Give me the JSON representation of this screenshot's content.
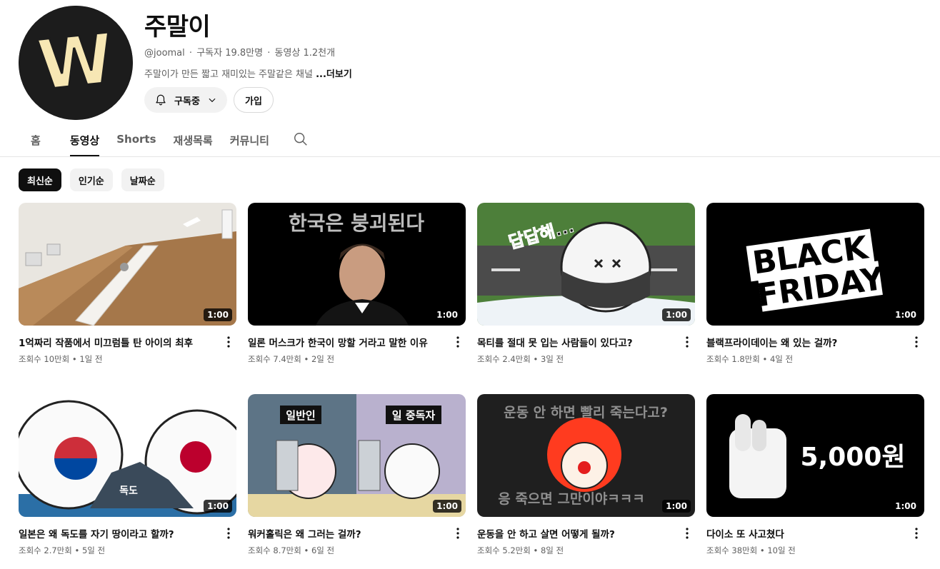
{
  "channel": {
    "name": "주말이",
    "handle": "@joomal",
    "subscribers": "구독자 19.8만명",
    "video_count": "동영상 1.2천개",
    "separator": "·",
    "description": "주말이가 만든 짧고 재미있는 주말같은 채널",
    "more_label": "...더보기",
    "avatar_letter": "W",
    "subscribe_label": "구독중",
    "join_label": "가입"
  },
  "tabs": [
    {
      "label": "홈"
    },
    {
      "label": "동영상"
    },
    {
      "label": "Shorts"
    },
    {
      "label": "재생목록"
    },
    {
      "label": "커뮤니티"
    }
  ],
  "chips": [
    {
      "label": "최신순"
    },
    {
      "label": "인기순"
    },
    {
      "label": "날짜순"
    }
  ],
  "videos": [
    {
      "title": "1억짜리 작품에서 미끄럼틀 탄 아이의 최후",
      "views": "조회수 10만회",
      "age": "1일 전",
      "duration": "1:00"
    },
    {
      "title": "일론 머스크가 한국이 망할 거라고 말한 이유",
      "views": "조회수 7.4만회",
      "age": "2일 전",
      "duration": "1:00",
      "overlay": "한국은 붕괴된다"
    },
    {
      "title": "목티를 절대 못 입는 사람들이 있다고?",
      "views": "조회수 2.4만회",
      "age": "3일 전",
      "duration": "1:00",
      "overlay": "답답해..."
    },
    {
      "title": "블랙프라이데이는 왜 있는 걸까?",
      "views": "조회수 1.8만회",
      "age": "4일 전",
      "duration": "1:00",
      "overlay_line1": "BLACK",
      "overlay_line2": "FRIDAY"
    },
    {
      "title": "일본은 왜 독도를 자기 땅이라고 할까?",
      "views": "조회수 2.7만회",
      "age": "5일 전",
      "duration": "1:00",
      "overlay": "독도"
    },
    {
      "title": "워커홀릭은 왜 그러는 걸까?",
      "views": "조회수 8.7만회",
      "age": "6일 전",
      "duration": "1:00",
      "overlay_left": "일반인",
      "overlay_right": "일 중독자"
    },
    {
      "title": "운동을 안 하고 살면 어떻게 될까?",
      "views": "조회수 5.2만회",
      "age": "8일 전",
      "duration": "1:00",
      "overlay_top": "운동 안 하면 빨리 죽는다고?",
      "overlay_bottom": "응 죽으면 그만이야ㅋㅋㅋ"
    },
    {
      "title": "다이소 또 사고쳤다",
      "views": "조회수 38만회",
      "age": "10일 전",
      "duration": "1:00",
      "overlay": "5,000원"
    }
  ],
  "meta_dot": "•",
  "colors": {
    "text": "#0f0f0f",
    "secondary": "#606060",
    "chip_bg": "#f2f2f2",
    "avatar_bg": "#1c1c1c",
    "avatar_letter": "#f7e7b4"
  }
}
